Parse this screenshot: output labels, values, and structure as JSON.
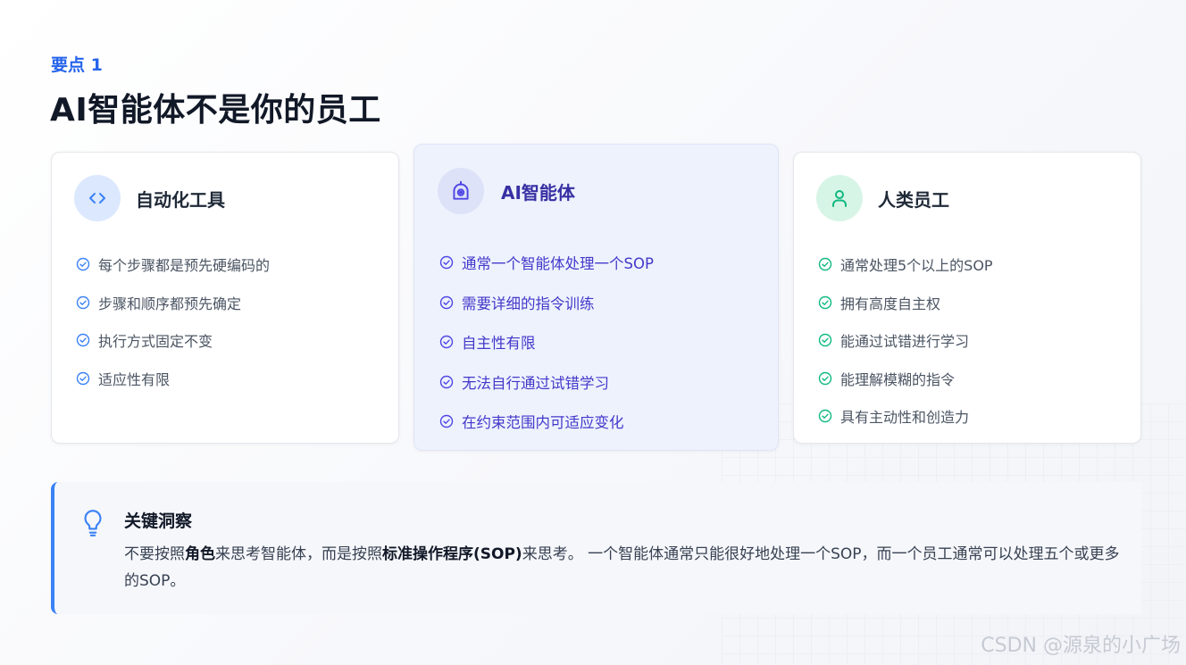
{
  "header": {
    "eyebrow": "要点 1",
    "title": "AI智能体不是你的员工"
  },
  "cards": [
    {
      "title": "自动化工具",
      "icon": "code-icon",
      "accent": "#3b82f6",
      "items": [
        "每个步骤都是预先硬编码的",
        "步骤和顺序都预先确定",
        "执行方式固定不变",
        "适应性有限"
      ]
    },
    {
      "title": "AI智能体",
      "icon": "robot-icon",
      "accent": "#4f46e5",
      "items": [
        "通常一个智能体处理一个SOP",
        "需要详细的指令训练",
        "自主性有限",
        "无法自行通过试错学习",
        "在约束范围内可适应变化"
      ]
    },
    {
      "title": "人类员工",
      "icon": "user-icon",
      "accent": "#10b981",
      "items": [
        "通常处理5个以上的SOP",
        "拥有高度自主权",
        "能通过试错进行学习",
        "能理解模糊的指令",
        "具有主动性和创造力"
      ]
    }
  ],
  "insight": {
    "title": "关键洞察",
    "icon": "lightbulb-icon",
    "text_1": "不要按照",
    "bold_1": "角色",
    "text_2": "来思考智能体，而是按照",
    "bold_2": "标准操作程序(SOP)",
    "text_3": "来思考。 一个智能体通常只能很好地处理一个SOP，而一个员工通常可以处理五个或更多的SOP。"
  },
  "watermark": "CSDN @源泉的小广场"
}
